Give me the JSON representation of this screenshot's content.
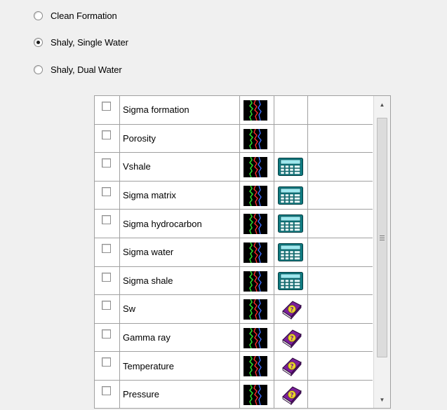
{
  "radio_options": [
    {
      "label": "Clean Formation",
      "checked": false
    },
    {
      "label": "Shaly, Single Water",
      "checked": true
    },
    {
      "label": "Shaly, Dual Water",
      "checked": false
    }
  ],
  "parameters": [
    {
      "name": "Sigma formation",
      "checked": false,
      "tool": "none"
    },
    {
      "name": "Porosity",
      "checked": false,
      "tool": "none"
    },
    {
      "name": "Vshale",
      "checked": false,
      "tool": "calculator"
    },
    {
      "name": "Sigma matrix",
      "checked": false,
      "tool": "calculator"
    },
    {
      "name": "Sigma hydrocarbon",
      "checked": false,
      "tool": "calculator"
    },
    {
      "name": "Sigma water",
      "checked": false,
      "tool": "calculator"
    },
    {
      "name": "Sigma shale",
      "checked": false,
      "tool": "calculator"
    },
    {
      "name": "Sw",
      "checked": false,
      "tool": "help-book"
    },
    {
      "name": "Gamma ray",
      "checked": false,
      "tool": "help-book"
    },
    {
      "name": "Temperature",
      "checked": false,
      "tool": "help-book"
    },
    {
      "name": "Pressure",
      "checked": false,
      "tool": "help-book"
    }
  ],
  "icons": {
    "log": "log-curve-icon",
    "calculator": "calculator-icon",
    "help_book": "help-book-icon"
  },
  "scrollbar": {
    "up": "▲",
    "down": "▼"
  }
}
